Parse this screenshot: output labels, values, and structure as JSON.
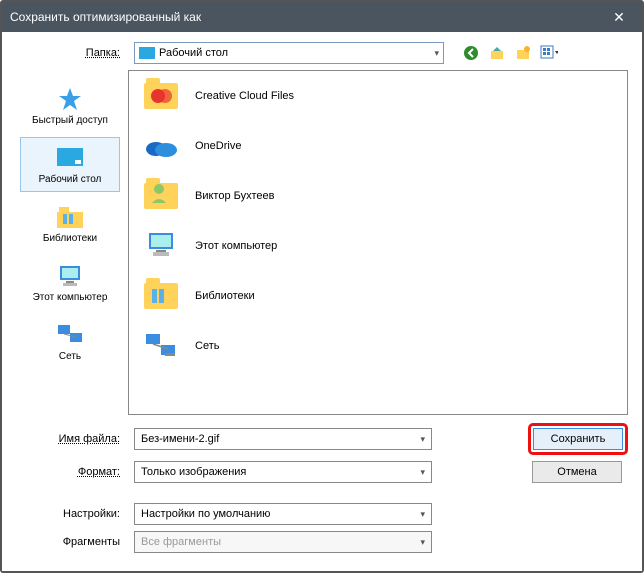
{
  "titlebar": {
    "title": "Сохранить оптимизированный как"
  },
  "toolbar": {
    "folder_label": "Папка:",
    "selected_folder": "Рабочий стол"
  },
  "sidebar": {
    "items": [
      {
        "label": "Быстрый доступ"
      },
      {
        "label": "Рабочий стол"
      },
      {
        "label": "Библиотеки"
      },
      {
        "label": "Этот компьютер"
      },
      {
        "label": "Сеть"
      }
    ]
  },
  "file_items": [
    {
      "label": "Creative Cloud Files",
      "icon": "cc"
    },
    {
      "label": "OneDrive",
      "icon": "onedrive"
    },
    {
      "label": "Виктор Бухтеев",
      "icon": "user"
    },
    {
      "label": "Этот компьютер",
      "icon": "pc"
    },
    {
      "label": "Библиотеки",
      "icon": "libraries"
    },
    {
      "label": "Сеть",
      "icon": "net"
    }
  ],
  "form": {
    "filename_label": "Имя файла:",
    "filename_value": "Без-имени-2.gif",
    "format_label": "Формат:",
    "format_value": "Только изображения",
    "settings_label": "Настройки:",
    "settings_value": "Настройки по умолчанию",
    "fragments_label": "Фрагменты",
    "fragments_value": "Все фрагменты",
    "save_button": "Сохранить",
    "cancel_button": "Отмена"
  }
}
